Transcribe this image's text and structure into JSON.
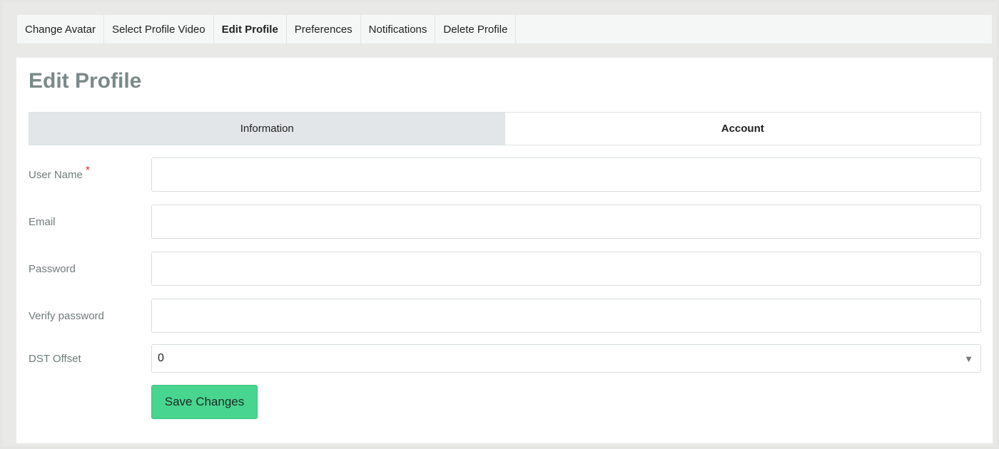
{
  "topnav": {
    "tabs": [
      {
        "label": "Change Avatar"
      },
      {
        "label": "Select Profile Video"
      },
      {
        "label": "Edit Profile"
      },
      {
        "label": "Preferences"
      },
      {
        "label": "Notifications"
      },
      {
        "label": "Delete Profile"
      }
    ],
    "active_tab": "Edit Profile"
  },
  "main": {
    "title": "Edit Profile",
    "subtabs": [
      {
        "label": "Information"
      },
      {
        "label": "Account"
      }
    ],
    "form": {
      "username": {
        "label": "User Name",
        "required_marker": "*",
        "value": ""
      },
      "email": {
        "label": "Email",
        "value": ""
      },
      "password": {
        "label": "Password",
        "value": ""
      },
      "verify_password": {
        "label": "Verify password",
        "value": ""
      },
      "dst_offset": {
        "label": "DST Offset",
        "value": "0",
        "arrow_icon": "triangle-down-icon"
      },
      "save_label": "Save Changes"
    }
  },
  "colors": {
    "save_button": "#48d58f",
    "required_marker": "#d9342b",
    "title": "#7a8a88"
  }
}
